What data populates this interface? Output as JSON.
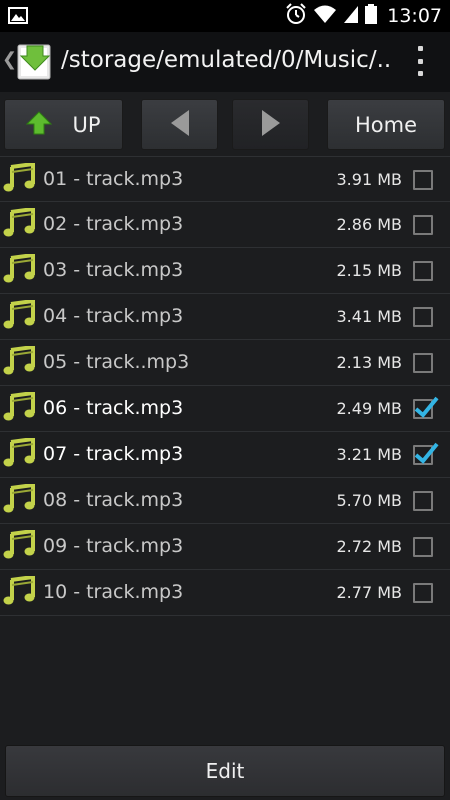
{
  "status_bar": {
    "time": "13:07",
    "icons": [
      "image-notification-icon",
      "alarm-icon",
      "wifi-icon",
      "signal-icon",
      "battery-icon"
    ]
  },
  "action_bar": {
    "path": "/storage/emulated/0/Music/...",
    "app_icon": "download-folder-icon",
    "accent_color": "#33b5e5"
  },
  "nav": {
    "up_label": "UP",
    "home_label": "Home"
  },
  "files": [
    {
      "name": "01 - track.mp3",
      "size": "3.91 MB",
      "checked": false
    },
    {
      "name": "02 - track.mp3",
      "size": "2.86 MB",
      "checked": false
    },
    {
      "name": "03 - track.mp3",
      "size": "2.15 MB",
      "checked": false
    },
    {
      "name": "04 - track.mp3",
      "size": "3.41 MB",
      "checked": false
    },
    {
      "name": "05 - track..mp3",
      "size": "2.13 MB",
      "checked": false
    },
    {
      "name": "06 - track.mp3",
      "size": "2.49 MB",
      "checked": true
    },
    {
      "name": "07 - track.mp3",
      "size": "3.21 MB",
      "checked": true
    },
    {
      "name": "08 - track.mp3",
      "size": "5.70 MB",
      "checked": false
    },
    {
      "name": "09 - track.mp3",
      "size": "2.72 MB",
      "checked": false
    },
    {
      "name": "10 - track.mp3",
      "size": "2.77 MB",
      "checked": false
    }
  ],
  "bottom": {
    "edit_label": "Edit"
  }
}
